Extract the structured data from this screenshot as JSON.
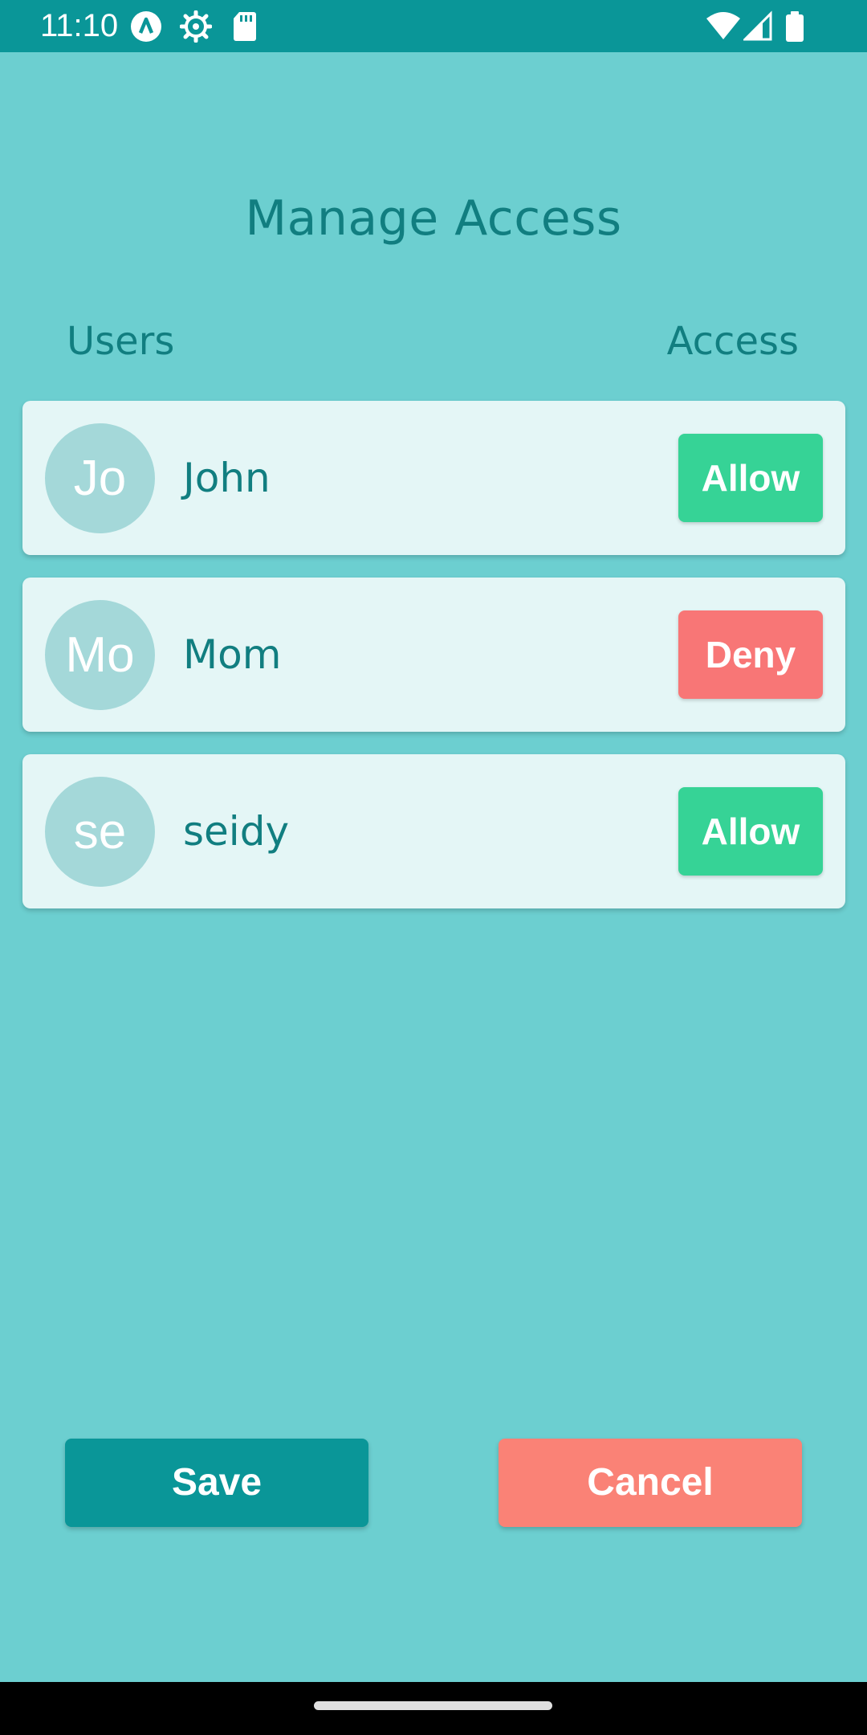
{
  "status_bar": {
    "time": "11:10",
    "left_icons": [
      "app-a-icon",
      "gear-icon",
      "sd-card-icon"
    ],
    "right_icons": [
      "wifi-icon",
      "signal-icon",
      "battery-icon"
    ]
  },
  "page": {
    "title": "Manage Access",
    "users_header": "Users",
    "access_header": "Access"
  },
  "users": [
    {
      "initials": "Jo",
      "name": "John",
      "access": "Allow"
    },
    {
      "initials": "Mo",
      "name": "Mom",
      "access": "Deny"
    },
    {
      "initials": "se",
      "name": "seidy",
      "access": "Allow"
    }
  ],
  "actions": {
    "save_label": "Save",
    "cancel_label": "Cancel"
  },
  "colors": {
    "background": "#6ccfd0",
    "status_bar": "#0a9698",
    "primary_text": "#117e80",
    "card": "#e4f6f6",
    "avatar": "#a4d8d9",
    "allow": "#36d396",
    "deny": "#f87676",
    "save": "#0a9698",
    "cancel": "#fa8276"
  }
}
